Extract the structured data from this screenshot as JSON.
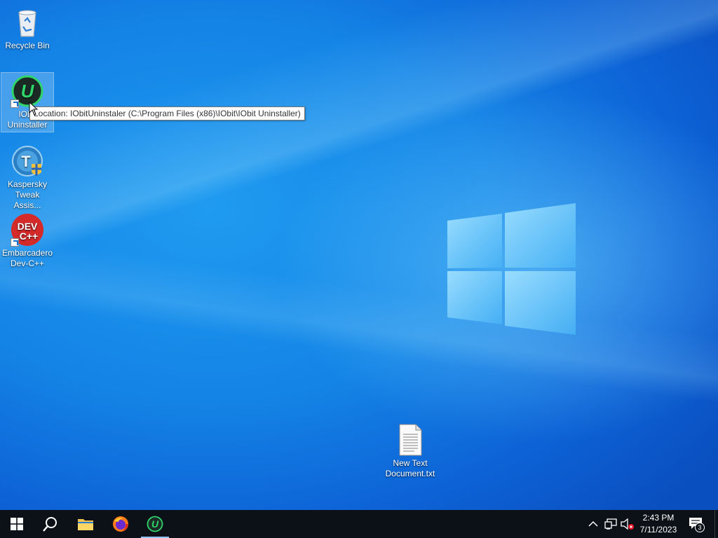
{
  "desktop": {
    "icons": [
      {
        "label": "Recycle Bin",
        "icon": "recycle-bin-icon"
      },
      {
        "label": "IObit Uninstaller",
        "icon": "iobit-uninstaller-icon",
        "selected": true
      },
      {
        "label": "Kaspersky Tweak Assis...",
        "icon": "kaspersky-tweak-icon"
      },
      {
        "label": "Embarcadero Dev-C++",
        "icon": "devcpp-icon"
      },
      {
        "label": "New Text Document.txt",
        "icon": "text-file-icon"
      }
    ],
    "tooltip": "Location: IObitUninstaler (C:\\Program Files (x86)\\IObit\\IObit Uninstaller)",
    "devcpp_badge_top": "DEV",
    "devcpp_badge_bottom": "C++"
  },
  "taskbar": {
    "items": [
      {
        "name": "start",
        "icon": "windows-start-icon"
      },
      {
        "name": "search",
        "icon": "search-icon"
      },
      {
        "name": "file-explorer",
        "icon": "folder-icon"
      },
      {
        "name": "firefox",
        "icon": "firefox-icon"
      },
      {
        "name": "iobit-uninstaller",
        "icon": "iobit-uninstaller-icon",
        "active": true
      }
    ],
    "tray": {
      "time": "2:43 PM",
      "date": "7/11/2023",
      "notification_count": "3"
    }
  },
  "colors": {
    "taskbar_bg": "#0b1117",
    "accent": "#8fc3f5",
    "iobit_green": "#2fd46a",
    "devcpp_red": "#d42a2a"
  }
}
